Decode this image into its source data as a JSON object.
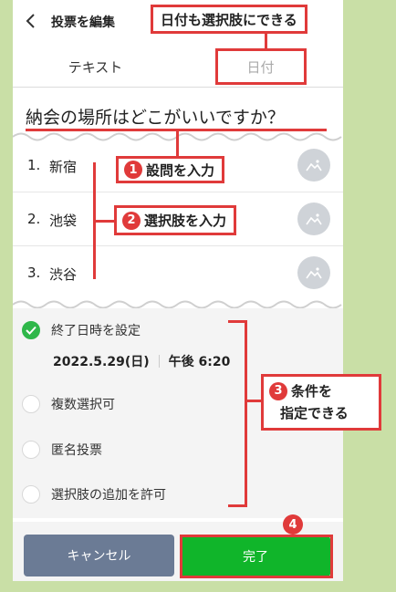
{
  "header": {
    "title": "投票を編集"
  },
  "tabs": [
    {
      "label": "テキスト"
    },
    {
      "label": "日付"
    }
  ],
  "question": "納会の場所はどこがいいですか？",
  "options": [
    {
      "num": "1.",
      "text": "新宿"
    },
    {
      "num": "2.",
      "text": "池袋"
    },
    {
      "num": "3.",
      "text": "渋谷"
    }
  ],
  "settings": {
    "end_date_label": "終了日時を設定",
    "date": "2022.5.29(日)",
    "time": "午後 6:20",
    "multi_select": "複数選択可",
    "anonymous": "匿名投票",
    "allow_add": "選択肢の追加を許可"
  },
  "footer": {
    "cancel": "キャンセル",
    "done": "完了"
  },
  "annotations": {
    "date_choice": "日付も選択肢にできる",
    "step1_num": "1",
    "step1": "設問を入力",
    "step2_num": "2",
    "step2": "選択肢を入力",
    "step3_num": "3",
    "step3_line1": "条件を",
    "step3_line2": "指定できる",
    "step4_num": "4"
  },
  "colors": {
    "accent": "#e03a3a",
    "done_green": "#10b52a",
    "cancel": "#6b7b95",
    "check_green": "#2fb74a",
    "background": "#c9dfa6"
  }
}
